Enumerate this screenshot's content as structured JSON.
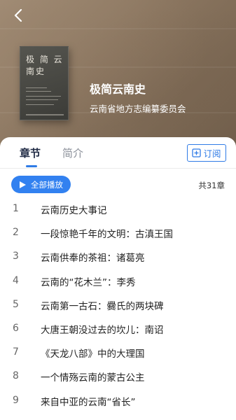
{
  "header": {
    "back_icon": "chevron-left-icon"
  },
  "book": {
    "title": "极简云南史",
    "author": "云南省地方志编纂委员会",
    "cover_title": "极 简 云南史"
  },
  "tabs": [
    {
      "label": "章节",
      "active": true
    },
    {
      "label": "简介",
      "active": false
    }
  ],
  "subscribe": {
    "label": "订阅",
    "icon": "add-square-icon"
  },
  "play_all": {
    "label": "全部播放",
    "icon": "play-icon"
  },
  "total_label": "共31章",
  "chapters": [
    {
      "num": "1",
      "title": "云南历史大事记"
    },
    {
      "num": "2",
      "title": "一段惊艳千年的文明：古滇王国"
    },
    {
      "num": "3",
      "title": "云南供奉的茶祖：诸葛亮"
    },
    {
      "num": "4",
      "title": "云南的“花木兰”：李秀"
    },
    {
      "num": "5",
      "title": "云南第一古石：爨氏的两块碑"
    },
    {
      "num": "6",
      "title": "大唐王朝没过去的坎儿：南诏"
    },
    {
      "num": "7",
      "title": "《天龙八部》中的大理国"
    },
    {
      "num": "8",
      "title": "一个情殇云南的蒙古公主"
    },
    {
      "num": "9",
      "title": "来自中亚的云南“省长”"
    }
  ],
  "colors": {
    "accent": "#3281f0",
    "tab_active": "#1f2a44",
    "tab_inactive": "#8a8f99"
  }
}
